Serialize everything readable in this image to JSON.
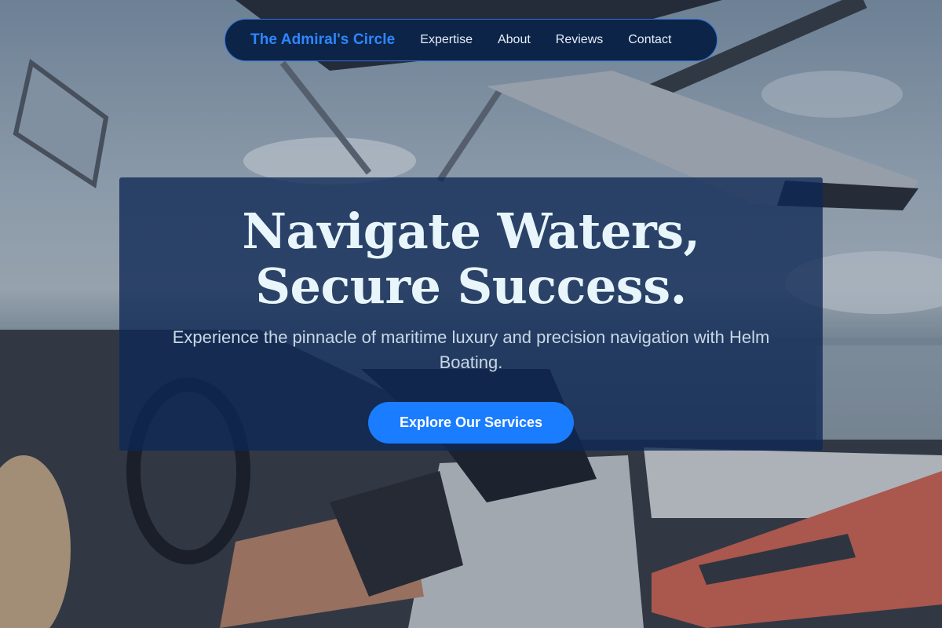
{
  "nav": {
    "brand": "The Admiral's Circle",
    "links": [
      "Expertise",
      "About",
      "Reviews",
      "Contact"
    ]
  },
  "hero": {
    "title": "Navigate Waters, Secure Success.",
    "subtitle": "Experience the pinnacle of maritime luxury and precision navigation with Helm Boating.",
    "cta_label": "Explore Our Services"
  },
  "colors": {
    "brand": "#2f86ff",
    "nav_bg": "#0b2448",
    "card_bg": "#0e2854",
    "cta": "#1a7cff",
    "title": "#e8f6fb"
  }
}
